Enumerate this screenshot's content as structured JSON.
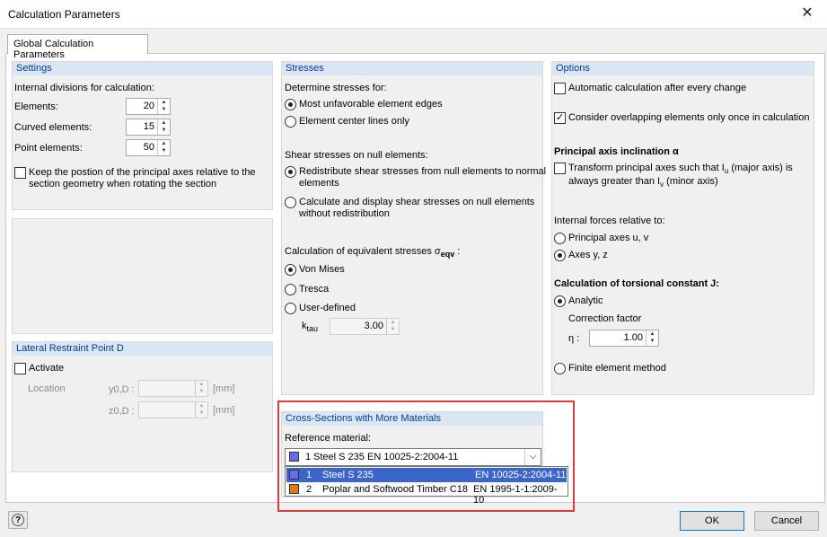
{
  "window": {
    "title": "Calculation Parameters",
    "close": "✕"
  },
  "tab": {
    "label": "Global Calculation Parameters"
  },
  "settings": {
    "header": "Settings",
    "divisions_label": "Internal divisions for calculation:",
    "elements_label": "Elements:",
    "elements_value": "20",
    "curved_label": "Curved elements:",
    "curved_value": "15",
    "point_label": "Point elements:",
    "point_value": "50",
    "keep_label_1": "Keep the postion of the principal axes relative to the",
    "keep_label_2": "section geometry when rotating the section"
  },
  "lateral": {
    "header": "Lateral Restraint Point D",
    "activate": "Activate",
    "location": "Location",
    "y_label": "y0,D :",
    "z_label": "z0,D :",
    "unit": "[mm]"
  },
  "stresses": {
    "header": "Stresses",
    "determine": "Determine stresses for:",
    "opt1": "Most unfavorable element edges",
    "opt2": "Element center lines only",
    "shear": "Shear stresses on null elements:",
    "shear1a": "Redistribute shear stresses from null elements to normal",
    "shear1b": "elements",
    "shear2a": "Calculate and display shear stresses on null elements",
    "shear2b": "without redistribution",
    "equiv": "Calculation of equivalent stresses σ",
    "equiv_sub": "eqv",
    "equiv_tail": " :",
    "vm": "Von Mises",
    "tresca": "Tresca",
    "user": "User-defined",
    "ktau_label": "k",
    "ktau_sub": "tau",
    "ktau_value": "3.00"
  },
  "options": {
    "header": "Options",
    "auto": "Automatic calculation after every change",
    "overlap": "Consider overlapping elements only once in calculation",
    "principal": "Principal axis inclination α",
    "transform1": "Transform principal axes such that I",
    "transform1_sub": "u",
    "transform1_tail": " (major axis) is",
    "transform2": "always greater than I",
    "transform2_sub": "v",
    "transform2_tail": " (minor axis)",
    "forces": "Internal forces relative to:",
    "principal_uv": "Principal axes u, v",
    "axes_yz": "Axes y, z",
    "torsion": "Calculation of torsional constant J:",
    "analytic": "Analytic",
    "correction": "Correction factor",
    "eta_label": "η :",
    "eta_value": "1.00",
    "fem": "Finite element method"
  },
  "materials": {
    "header": "Cross-Sections with More Materials",
    "ref_label": "Reference material:",
    "selected": {
      "num": "1",
      "name": "Steel S 235",
      "norm": "EN 10025-2:2004-11",
      "color": "#6a6af0"
    },
    "items": [
      {
        "num": "1",
        "name": "Steel S 235",
        "norm": "EN 10025-2:2004-11",
        "color": "#6a6af0"
      },
      {
        "num": "2",
        "name": "Poplar and Softwood Timber C18",
        "norm": "EN 1995-1-1:2009-10",
        "color": "#e07a10"
      }
    ]
  },
  "footer": {
    "ok": "OK",
    "cancel": "Cancel",
    "help": "?"
  }
}
